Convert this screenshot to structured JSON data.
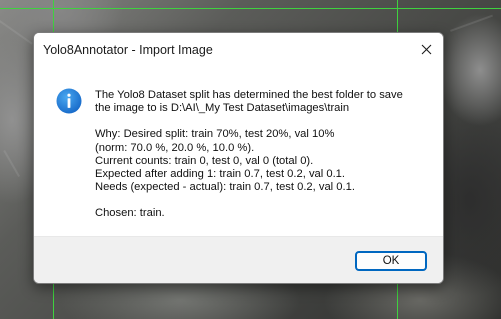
{
  "dialog": {
    "title": "Yolo8Annotator - Import Image",
    "icon": "info-icon",
    "close_icon": "close-icon",
    "message_lines": [
      "The Yolo8 Dataset split has determined the best folder to save",
      "the image to is D:\\AI\\_My Test Dataset\\images\\train",
      "",
      "Why: Desired split: train 70%, test 20%, val 10%",
      "(norm: 70.0 %, 20.0 %, 10.0 %).",
      "Current counts: train 0, test 0, val 0 (total 0).",
      "Expected after adding 1: train 0.7, test 0.2, val 0.1.",
      "Needs (expected - actual): train 0.7, test 0.2, val 0.1.",
      "",
      "Chosen: train."
    ],
    "ok_label": "OK"
  },
  "colors": {
    "accent": "#0067c0",
    "info_icon": "#1a7fd4",
    "guide_lines": "#3fd23f"
  }
}
